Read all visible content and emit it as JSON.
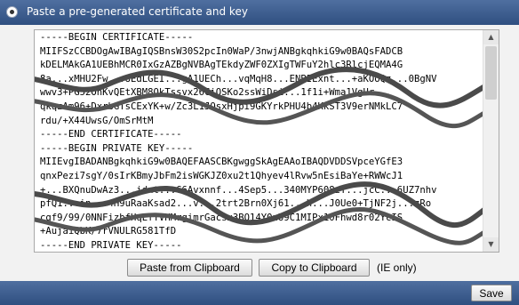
{
  "header": {
    "option_label": "Paste a pre-generated certificate and key",
    "option_selected": true
  },
  "certificate_text": {
    "lines": [
      "-----BEGIN CERTIFICATE-----",
      "MIIFSzCCBDOgAwIBAgIQSBnsW30S2pcIn0WaP/3nwjANBgkqhkiG9w0BAQsFADCB",
      "kDELMAkGA1UEBhMCR0IxGzAZBgNVBAgTEkdyZWF0ZXIgTWFuY2hlc3RlcjEQMA4G",
      "8a...xMHU2Fw...8EdLGEI...gA1UECh...vqMqH8...ENBIExnt...+aKOoQz...0BgNV",
      "wwv3+PG52OhKvQEtXBM8OkTssvx26CiQSKo2ssWiDsi...1f1i+Wma1VgUr...",
      "qkqzAm96+DxrbGTsCExYK+w/Zc3L1JOsxHjpi9GKYrkPHU4b4KkST3V9erNMkLC7",
      "rdu/+X44UwsG/OmSrMtM",
      "-----END CERTIFICATE-----",
      "-----BEGIN PRIVATE KEY-----",
      "MIIEvgIBADANBgkqhkiG9w0BAQEFAASCBKgwggSkAgEAAoIBAQDVDDSVpceYGfE3",
      "qnxPezi7sgY/0sIrKBmyJbFm2isWGKJZ0xu2t1Qhyev4lRvw5nEsiBaYe+RWWcJ1",
      "+...BXQnuDwAz3...idnt...G6Avxnnf...4Sep5...340MYP608zY...jcC...6UZ7nhv",
      "pfQ1...in...4H9uRaaKsad2...v...2trt2Brn0Xj61...h...J0Ue0+TjNF2j...zRo",
      "cgf9/99/0NNFizbfHqEfYVHMrgimrGacsx3BQ14Y0nU9C1MIPx10Fhwd8r02YcIS",
      "+AujaiQbK/7rVNULRG581TfD",
      "-----END PRIVATE KEY-----"
    ]
  },
  "buttons": {
    "paste_label": "Paste from Clipboard",
    "copy_label": "Copy to Clipboard",
    "ie_note": "(IE only)",
    "save_label": "Save"
  },
  "colors": {
    "bar_blue": "#2f4f80",
    "panel_bg": "#f2f2f2",
    "scribble": "#4a4a4a"
  }
}
